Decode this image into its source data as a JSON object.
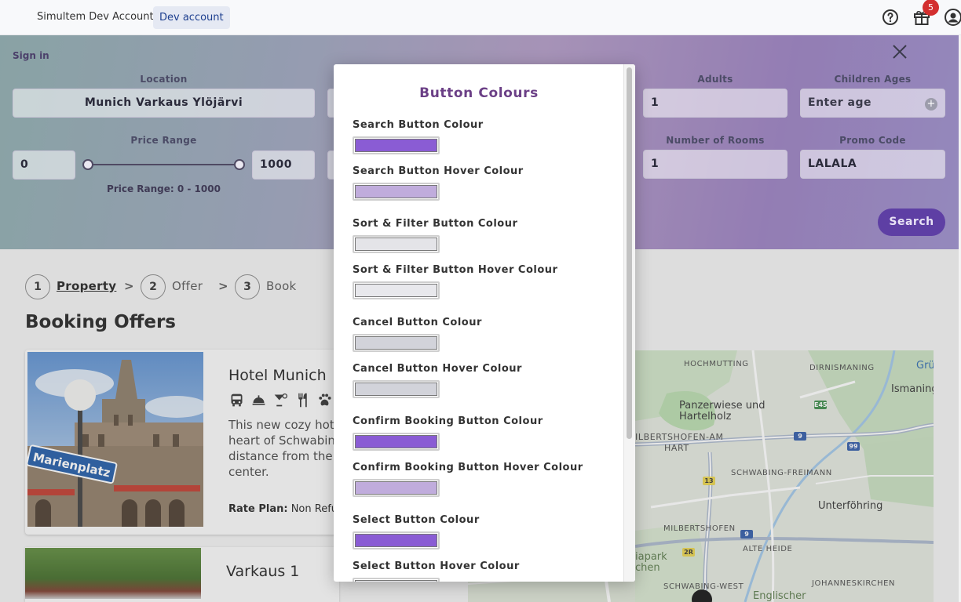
{
  "topbar": {
    "account_name": "Simultem Dev Account",
    "account_badge": "Dev account",
    "notification_count": "5"
  },
  "search": {
    "sign_in": "Sign in",
    "location_label": "Location",
    "location_value": "Munich  Varkaus  Ylöjärvi",
    "adults_label": "Adults",
    "adults_value": "1",
    "children_label": "Children Ages",
    "children_placeholder": "Enter age",
    "price_label": "Price Range",
    "price_min": "0",
    "price_max": "1000",
    "price_caption": "Price Range: 0 - 1000",
    "rooms_label": "Number of Rooms",
    "rooms_value": "1",
    "promo_label": "Promo Code",
    "promo_value": "LALALA",
    "search_button": "Search"
  },
  "steps": [
    {
      "num": "1",
      "label": "Property"
    },
    {
      "num": "2",
      "label": "Offer"
    },
    {
      "num": "3",
      "label": "Book"
    }
  ],
  "step_separator": ">",
  "page_title": "Booking Offers",
  "offers": [
    {
      "name": "Hotel Munich",
      "description_lines": [
        "This new cozy hotel",
        "heart of Schwabing",
        "distance from the",
        "center."
      ],
      "rate_plan_label": "Rate Plan:",
      "rate_plan_value": "Non Refundable"
    },
    {
      "name": "Varkaus 1"
    }
  ],
  "photo_sign": "Marienplatz",
  "map": {
    "labels": [
      "HOCHMUTTING",
      "DIRNISMANING",
      "Ismaning",
      "Panzerwiese und Hartelholz",
      "ILBERTSHOFEN-AM",
      "HART",
      "SCHWABING-FREIMANN",
      "Unterföhring",
      "MILBERTSHOFEN",
      "ALTE HEIDE",
      "chen",
      "SCHWABING-WEST",
      "JOHANNESKIRCHEN",
      "Englischer",
      "iapark",
      "Grü"
    ],
    "road_badges": [
      "E45",
      "9",
      "99",
      "13",
      "9",
      "2R"
    ]
  },
  "modal": {
    "title": "Button Colours",
    "colors": [
      {
        "label": "Search Button Colour",
        "value": "#8a5cd4"
      },
      {
        "label": "Search Button Hover Colour",
        "value": "#c0acdc"
      },
      {
        "label": "Sort & Filter Button Colour",
        "value": "#e4e4e8"
      },
      {
        "label": "Sort & Filter Button Hover Colour",
        "value": "#e8e8ec"
      },
      {
        "label": "Cancel Button Colour",
        "value": "#d2d3da"
      },
      {
        "label": "Cancel Button Hover Colour",
        "value": "#d2d3da"
      },
      {
        "label": "Confirm Booking Button Colour",
        "value": "#8a5cd4"
      },
      {
        "label": "Confirm Booking Button Hover Colour",
        "value": "#c0acdc"
      },
      {
        "label": "Select Button Colour",
        "value": "#8a5cd4"
      },
      {
        "label": "Select Button Hover Colour",
        "value": "#e4e4e8"
      }
    ]
  },
  "icons": {
    "help": "help-circle-icon",
    "gift": "gift-box-icon",
    "user": "user-account-icon",
    "close": "close-icon",
    "add": "plus-circle-icon",
    "amenities": [
      "bus-icon",
      "room-service-icon",
      "cocktail-icon",
      "restaurant-icon",
      "pets-icon"
    ]
  }
}
